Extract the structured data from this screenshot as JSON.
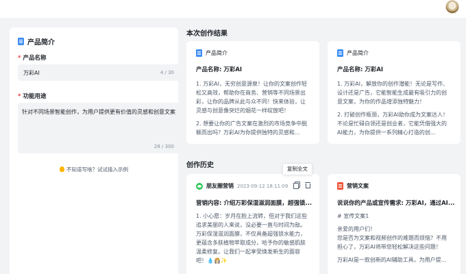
{
  "left_panel": {
    "title": "产品简介",
    "name_label": "产品名称",
    "name_value": "万彩AI",
    "name_count": "4 / 30",
    "purpose_label": "功能用途",
    "purpose_value": "针对不同场景智能创作，为用户提供更有价值的灵感和创意文案",
    "purpose_count": "28 / 300",
    "hint": "不知道写啥？试试插入示例"
  },
  "results": {
    "section_title": "本次创作结果",
    "cards": [
      {
        "type_label": "产品简介",
        "title": "产品名称: 万彩AI",
        "paragraphs": [
          "1. 万彩AI，无穷创意源泉！让你的文案创作轻松又高效，帮助你在商务、营销等不同场景出彩，让你的品牌从此与众不同！快来体验，让灵感与创意像突烂的烟花一样绽放吧！",
          "2. 想要让你的广告文案在激烈的市场竞争中脱颖而出吗？万彩AI为你提供独特的灵感和..."
        ]
      },
      {
        "type_label": "产品简介",
        "title": "产品名称: 万彩AI",
        "paragraphs": [
          "1. 万彩AI，解放你的创作潜能！无论是写作、设计还是广告，它能智能生成最有吸引力的创意文案，为你的作品增添独特魅力！",
          "2. 打破创作瓶颈，万彩AI助你成为文案达人！不论是忙碌白领还是创业者，它能凭借强大的AI能力，为你提供一系列精心打造的创..."
        ]
      }
    ]
  },
  "history": {
    "section_title": "创作历史",
    "tooltip": "复制全文",
    "cards": [
      {
        "type_label": "朋友圈营销",
        "time": "2023-09-12 18:11:09",
        "title": "营销内容: 介绍万彩保湿滋润面膜，超强锁...",
        "paragraphs": [
          "1. 小心愿：岁月在脸上流转，但对于我们这些追求美丽的人来说，没必要一直与时间为敌。万彩保湿滋润面膜，不仅具备超强锁水能力，更蕴含多肤植物萃取成分，哈予你的敏感肌肤温柔修复。让我们一起享受焕发新生的面容吧！💧👸🏻✨",
          "..."
        ]
      },
      {
        "type_label": "营销文案",
        "title": "说说你的产品或宣传需求: 万彩AI，通过AI...",
        "paragraphs": [
          "# 宣传文案1",
          "亲爱的用户们！\n您是否为文案和视频创作的难题而烦恼？不用担心了，万彩AI将带您轻松解决这些问题！",
          "万彩AI是一款创新的AI辅助工具，为用户提..."
        ]
      }
    ]
  }
}
